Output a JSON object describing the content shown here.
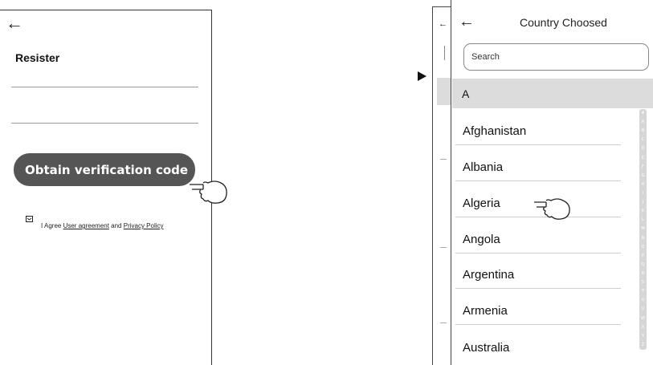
{
  "left": {
    "back_icon": "back-arrow-icon",
    "title": "Resister",
    "obtain_label": "Obtain verification code",
    "agree_prefix": "I Agree ",
    "user_agreement": "User agreement",
    "and_text": " and ",
    "privacy_policy": "Privacy Policy"
  },
  "right": {
    "back_icon": "back-arrow-icon",
    "title": "Country Choosed",
    "search_placeholder": "Search",
    "section_letter": "A",
    "countries": [
      "Afghanistan",
      "Albania",
      "Algeria",
      "Angola",
      "Argentina",
      "Armenia",
      "Australia"
    ],
    "index_letters": [
      "#",
      "A",
      "B",
      "C",
      "D",
      "E",
      "F",
      "G",
      "H",
      "I",
      "J",
      "K",
      "L",
      "M",
      "N",
      "O",
      "P",
      "Q",
      "R",
      "S",
      "T",
      "U",
      "V",
      "W",
      "X",
      "Y",
      "Z"
    ]
  },
  "icons": {
    "pointer": "pointing-hand-icon",
    "arrow": "play-arrow-icon",
    "checkbox": "checkbox-icon"
  }
}
